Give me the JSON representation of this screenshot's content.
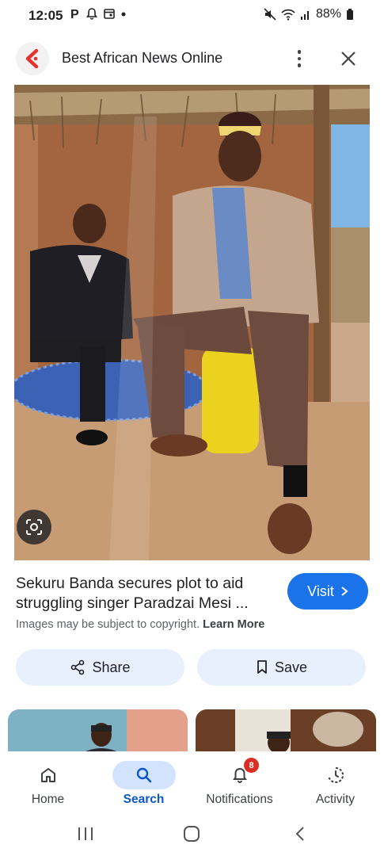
{
  "status_bar": {
    "time": "12:05",
    "battery": "88%"
  },
  "header": {
    "site_title": "Best African News Online",
    "brand_color": "#e5322d"
  },
  "result": {
    "headline": "Sekuru Banda secures plot to aid struggling singer Paradzai Mesi ...",
    "visit_label": "Visit",
    "copyright_text": "Images may be subject to copyright.",
    "learn_more": "Learn More"
  },
  "actions": {
    "share_label": "Share",
    "save_label": "Save"
  },
  "bottom_nav": {
    "items": [
      {
        "label": "Home",
        "icon": "home-icon"
      },
      {
        "label": "Search",
        "icon": "search-icon",
        "active": true
      },
      {
        "label": "Notifications",
        "icon": "bell-icon",
        "badge": "8"
      },
      {
        "label": "Activity",
        "icon": "activity-icon"
      }
    ]
  },
  "colors": {
    "accent": "#1a73e8",
    "pill_bg": "#e8f0fe",
    "active_nav": "#0b57d0",
    "badge": "#d93025"
  }
}
